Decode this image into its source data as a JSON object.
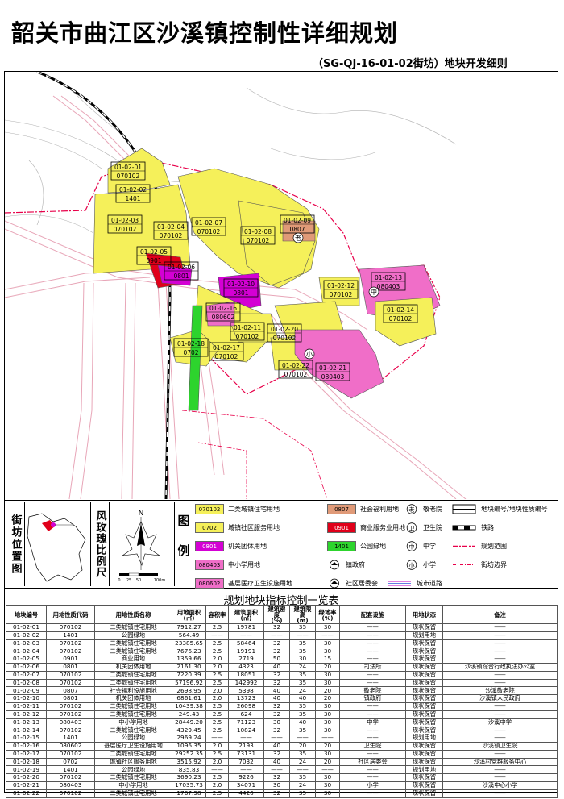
{
  "title": "韶关市曲江区沙溪镇控制性详细规划",
  "subtitle": "（SG-QJ-16-01-02街坊）地块开发细则",
  "colors": {
    "residential": "#f5f05a",
    "community_service": "#f5f05a",
    "welfare": "#e09a78",
    "commercial": "#e0001a",
    "gov": "#d400d4",
    "green": "#2dd42d",
    "school": "#f06ec8",
    "medical": "#f06ec8",
    "road": "#f2b6c6",
    "boundary": "#e8004a"
  },
  "map": {
    "parcels": [
      {
        "id": "01-02-01",
        "code": "070102"
      },
      {
        "id": "01-02-02",
        "code": "1401"
      },
      {
        "id": "01-02-03",
        "code": "070102"
      },
      {
        "id": "01-02-04",
        "code": "070102"
      },
      {
        "id": "01-02-05",
        "code": "0901"
      },
      {
        "id": "01-02-06",
        "code": "0801"
      },
      {
        "id": "01-02-07",
        "code": "070102"
      },
      {
        "id": "01-02-08",
        "code": "070102"
      },
      {
        "id": "01-02-09",
        "code": "0807"
      },
      {
        "id": "01-02-10",
        "code": "0801"
      },
      {
        "id": "01-02-11",
        "code": "070102"
      },
      {
        "id": "01-02-12",
        "code": "070102"
      },
      {
        "id": "01-02-13",
        "code": "080403"
      },
      {
        "id": "01-02-14",
        "code": "070102"
      },
      {
        "id": "01-02-16",
        "code": "080602"
      },
      {
        "id": "01-02-17",
        "code": "070102"
      },
      {
        "id": "01-02-18",
        "code": "0702"
      },
      {
        "id": "01-02-20",
        "code": "070102"
      },
      {
        "id": "01-02-21",
        "code": "080403"
      },
      {
        "id": "01-02-22",
        "code": "070102"
      }
    ],
    "markers": {
      "elderly": "老",
      "middle": "中",
      "primary": "小"
    }
  },
  "legend": {
    "location_title": "街坊位置图",
    "scale_title": "风玫瑰比例尺",
    "north": "N",
    "scale_ticks": [
      "0",
      "25",
      "50",
      "100m"
    ],
    "legend_title": "图例",
    "items": [
      {
        "code": "070102",
        "label": "二类城镇住宅用地"
      },
      {
        "code": "0702",
        "label": "城镇社区服务用地"
      },
      {
        "code": "0801",
        "label": "机关团体用地"
      },
      {
        "code": "080403",
        "label": "中小学用地"
      },
      {
        "code": "080602",
        "label": "基层医疗卫生设施用地"
      },
      {
        "code": "0807",
        "label": "社会福利用地"
      },
      {
        "code": "0901",
        "label": "商业服务业用地"
      },
      {
        "code": "1401",
        "label": "公园绿地"
      },
      {
        "code": "",
        "label": "镇政府",
        "icon": "town-government-icon"
      },
      {
        "code": "",
        "label": "社区居委会",
        "icon": "community-committee-icon"
      }
    ],
    "symbols": [
      {
        "glyph": "老",
        "label": "敬老院"
      },
      {
        "glyph": "卫",
        "label": "卫生院"
      },
      {
        "glyph": "中",
        "label": "中学"
      },
      {
        "glyph": "小",
        "label": "小学"
      }
    ],
    "line_symbols": [
      {
        "label": "地块编号/地块性质编号"
      },
      {
        "label": "铁路"
      },
      {
        "label": "规划范围"
      },
      {
        "label": "街坊边界"
      },
      {
        "label": "城市道路"
      }
    ]
  },
  "table": {
    "title": "规划地块指标控制一览表",
    "headers": [
      "地块编号",
      "用地性质代码",
      "用地性质名称",
      "用地面积\n(㎡)",
      "容积率",
      "建筑面积\n(㎡)",
      "建筑密度\n(%)",
      "建筑限高\n(m)",
      "绿地率\n(%)",
      "配套设施",
      "用地状态",
      "备注"
    ],
    "rows": [
      [
        "01-02-01",
        "070102",
        "二类城镇住宅用地",
        "7912.27",
        "2.5",
        "19781",
        "32",
        "35",
        "30",
        "——",
        "现状保留",
        "——"
      ],
      [
        "01-02-02",
        "1401",
        "公园绿地",
        "564.49",
        "——",
        "——",
        "——",
        "——",
        "——",
        "——",
        "规划用地",
        "——"
      ],
      [
        "01-02-03",
        "070102",
        "二类城镇住宅用地",
        "23385.65",
        "2.5",
        "58464",
        "32",
        "35",
        "30",
        "——",
        "现状保留",
        "——"
      ],
      [
        "01-02-04",
        "070102",
        "二类城镇住宅用地",
        "7676.23",
        "2.5",
        "19191",
        "32",
        "35",
        "30",
        "——",
        "现状保留",
        "——"
      ],
      [
        "01-02-05",
        "0901",
        "商业用地",
        "1359.66",
        "2.0",
        "2719",
        "50",
        "30",
        "15",
        "——",
        "现状保留",
        "——"
      ],
      [
        "01-02-06",
        "0801",
        "机关团体用地",
        "2161.30",
        "2.0",
        "4323",
        "40",
        "24",
        "20",
        "司法所",
        "现状保留",
        "沙溪镇综合行政执法办公室"
      ],
      [
        "01-02-07",
        "070102",
        "二类城镇住宅用地",
        "7220.39",
        "2.5",
        "18051",
        "32",
        "35",
        "30",
        "——",
        "现状保留",
        "——"
      ],
      [
        "01-02-08",
        "070102",
        "二类城镇住宅用地",
        "57196.92",
        "2.5",
        "142992",
        "32",
        "35",
        "30",
        "——",
        "现状保留",
        "——"
      ],
      [
        "01-02-09",
        "0807",
        "社会福利设施用地",
        "2698.95",
        "2.0",
        "5398",
        "40",
        "24",
        "20",
        "敬老院",
        "现状保留",
        "沙溪敬老院"
      ],
      [
        "01-02-10",
        "0801",
        "机关团体用地",
        "6861.61",
        "2.0",
        "13723",
        "40",
        "40",
        "20",
        "镇政府",
        "现状保留",
        "沙溪镇人民政府"
      ],
      [
        "01-02-11",
        "070102",
        "二类城镇住宅用地",
        "10439.38",
        "2.5",
        "26098",
        "32",
        "35",
        "30",
        "——",
        "现状保留",
        "——"
      ],
      [
        "01-02-12",
        "070102",
        "二类城镇住宅用地",
        "249.43",
        "2.5",
        "624",
        "32",
        "35",
        "30",
        "——",
        "现状保留",
        "——"
      ],
      [
        "01-02-13",
        "080403",
        "中小学用地",
        "28449.20",
        "2.5",
        "71123",
        "30",
        "40",
        "30",
        "中学",
        "现状保留",
        "沙溪中学"
      ],
      [
        "01-02-14",
        "070102",
        "二类城镇住宅用地",
        "4329.45",
        "2.5",
        "10824",
        "32",
        "35",
        "30",
        "——",
        "现状保留",
        "——"
      ],
      [
        "01-02-15",
        "1401",
        "公园绿地",
        "2969.24",
        "——",
        "——",
        "——",
        "——",
        "——",
        "——",
        "规划用地",
        "——"
      ],
      [
        "01-02-16",
        "080602",
        "基层医疗卫生设施用地",
        "1096.35",
        "2.0",
        "2193",
        "40",
        "20",
        "20",
        "卫生院",
        "现状保留",
        "沙溪镇卫生院"
      ],
      [
        "01-02-17",
        "070102",
        "二类城镇住宅用地",
        "29252.35",
        "2.5",
        "73131",
        "32",
        "35",
        "30",
        "——",
        "现状保留",
        "——"
      ],
      [
        "01-02-18",
        "0702",
        "城镇社区服务用地",
        "3515.92",
        "2.0",
        "7032",
        "40",
        "24",
        "20",
        "社区居委会",
        "现状保留",
        "沙溪村党群服务中心"
      ],
      [
        "01-02-19",
        "1401",
        "公园绿地",
        "835.83",
        "——",
        "——",
        "——",
        "——",
        "——",
        "——",
        "规划用地",
        "——"
      ],
      [
        "01-02-20",
        "070102",
        "二类城镇住宅用地",
        "3690.23",
        "2.5",
        "9226",
        "32",
        "35",
        "30",
        "——",
        "现状保留",
        "——"
      ],
      [
        "01-02-21",
        "080403",
        "中小学用地",
        "17035.73",
        "2.0",
        "34071",
        "30",
        "24",
        "30",
        "小学",
        "现状保留",
        "沙溪中心小学"
      ],
      [
        "01-02-22",
        "070102",
        "二类城镇住宅用地",
        "1767.98",
        "2.5",
        "4420",
        "32",
        "35",
        "30",
        "——",
        "现状保留",
        "——"
      ]
    ]
  }
}
